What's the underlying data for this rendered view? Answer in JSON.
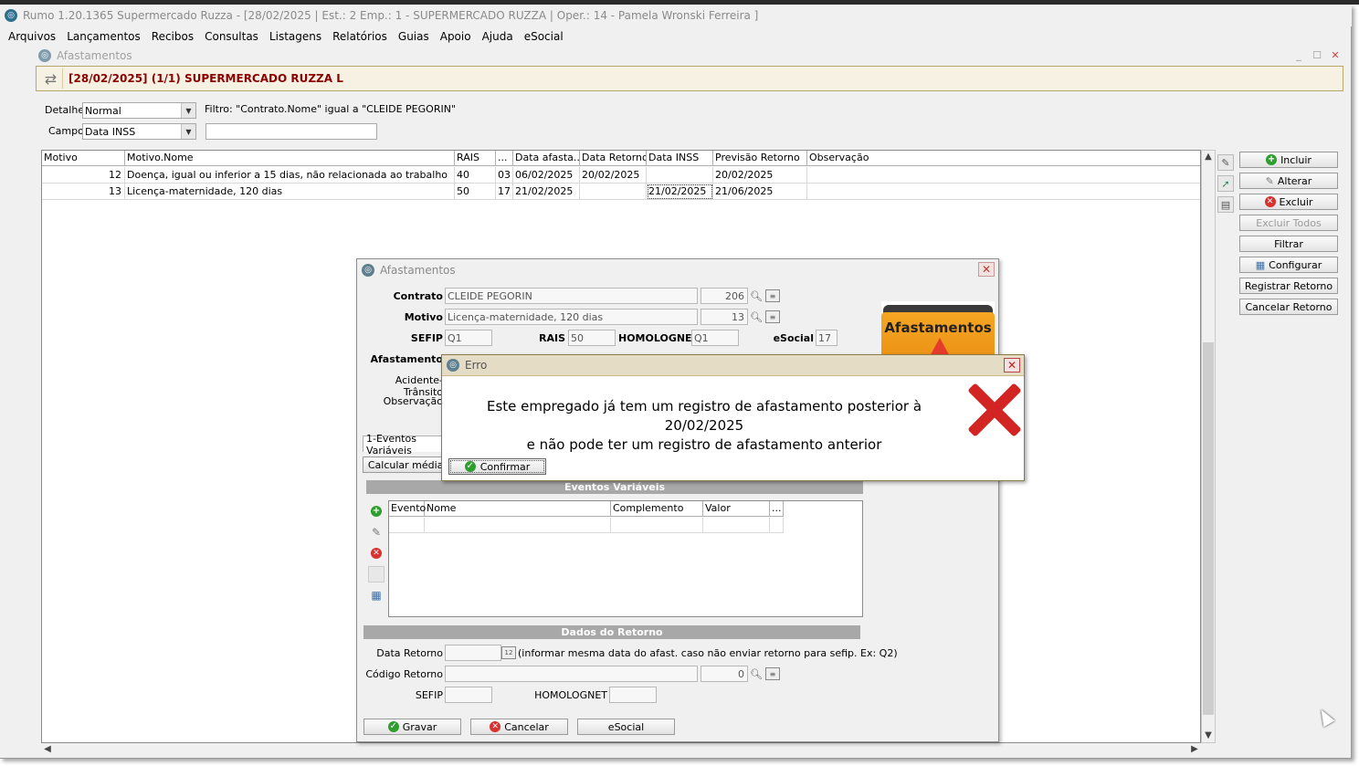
{
  "app": {
    "title": "Rumo 1.20.1365 Supermercado Ruzza - [28/02/2025 | Est.: 2 Emp.: 1 - SUPERMERCADO RUZZA | Oper.: 14 - Pamela Wronski Ferreira ]",
    "menu": [
      "Arquivos",
      "Lançamentos",
      "Recibos",
      "Consultas",
      "Listagens",
      "Relatórios",
      "Guias",
      "Apoio",
      "Ajuda",
      "eSocial"
    ]
  },
  "window": {
    "title": "Afastamentos",
    "header": "[28/02/2025] (1/1) SUPERMERCADO RUZZA L",
    "detalhe_label": "Detalhe",
    "detalhe_value": "Normal",
    "campo_label": "Campo",
    "campo_value": "Data INSS",
    "filter_text": "Filtro: \"Contrato.Nome\" igual a \"CLEIDE PEGORIN\"",
    "filter_input": ""
  },
  "grid": {
    "columns": [
      "Motivo",
      "Motivo.Nome",
      "RAIS",
      "...",
      "Data afasta...",
      "Data Retorno",
      "Data INSS",
      "Previsão Retorno",
      "Observação"
    ],
    "rows": [
      {
        "motivo": "12",
        "nome": "Doença, igual ou inferior a 15 dias, não relacionada ao trabalho",
        "rais": "40",
        "dots": "03",
        "data_afast": "06/02/2025",
        "data_retorno": "20/02/2025",
        "data_inss": "",
        "previsao": "20/02/2025",
        "obs": ""
      },
      {
        "motivo": "13",
        "nome": "Licença-maternidade, 120 dias",
        "rais": "50",
        "dots": "17",
        "data_afast": "21/02/2025",
        "data_retorno": "",
        "data_inss": "21/02/2025",
        "previsao": "21/06/2025",
        "obs": ""
      }
    ]
  },
  "side_buttons": {
    "incluir": "Incluir",
    "alterar": "Alterar",
    "excluir": "Excluir",
    "excluir_todos": "Excluir Todos",
    "filtrar": "Filtrar",
    "configurar": "Configurar",
    "registrar_retorno": "Registrar Retorno",
    "cancelar_retorno": "Cancelar Retorno"
  },
  "dialog": {
    "title": "Afastamentos",
    "contrato_label": "Contrato",
    "contrato_value": "CLEIDE PEGORIN",
    "contrato_code": "206",
    "motivo_label": "Motivo",
    "motivo_value": "Licença-maternidade, 120 dias",
    "motivo_code": "13",
    "sefip_label": "SEFIP",
    "sefip_value": "Q1",
    "rais_label": "RAIS",
    "rais_value": "50",
    "homolognet_label": "HOMOLOGNET",
    "homolognet_value": "Q1",
    "esocial_label": "eSocial",
    "esocial_value": "17",
    "afastamento_label": "Afastamento",
    "acidente_label": "Acidente-Trânsito",
    "observacao_label": "Observação",
    "folder_label": "Afastamentos",
    "tab_label": "1-Eventos Variáveis",
    "calcular_label": "Calcular médias",
    "eventos_header": "Eventos Variáveis",
    "eventos_columns": [
      "Evento",
      "Nome",
      "Complemento",
      "Valor",
      "..."
    ],
    "retorno_header": "Dados do Retorno",
    "data_retorno_label": "Data Retorno",
    "data_retorno_hint": "(informar mesma data do afast. caso não enviar retorno para sefip. Ex: Q2)",
    "codigo_retorno_label": "Código Retorno",
    "codigo_retorno_code": "0",
    "sefip2_label": "SEFIP",
    "homolognet2_label": "HOMOLOGNET",
    "gravar": "Gravar",
    "cancelar": "Cancelar",
    "esocial_btn": "eSocial",
    "calendar_glyph": "12"
  },
  "error": {
    "title": "Erro",
    "line1": "Este empregado já tem um registro de afastamento posterior à 20/02/2025",
    "line2": "e não pode ter um registro de afastamento anterior",
    "confirm": "Confirmar"
  }
}
